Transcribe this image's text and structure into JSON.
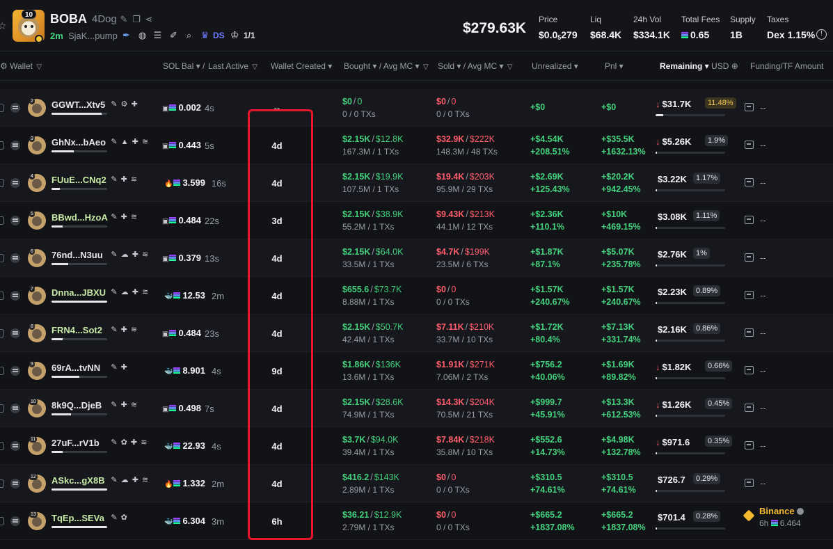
{
  "header": {
    "token_badge": "10",
    "token_name": "BOBA",
    "token_ticker": "4Dog",
    "age": "2m",
    "contract": "SjaK...pump",
    "ds_label": "DS",
    "holders_ratio": "1/1",
    "market_cap": "$279.63K",
    "stats": [
      {
        "label": "Price",
        "value_main": "$0.0",
        "value_sub": "5",
        "value_end": "279"
      },
      {
        "label": "Liq",
        "value": "$68.4K"
      },
      {
        "label": "24h Vol",
        "value": "$334.1K"
      },
      {
        "label": "Total Fees",
        "value": "0.65"
      },
      {
        "label": "Supply",
        "value": "1B"
      },
      {
        "label": "Taxes",
        "value": "Dex 1.15%"
      }
    ]
  },
  "columns": {
    "wallet": "Wallet",
    "sol_bal": "SOL Bal",
    "last_active": "Last Active",
    "wallet_created": "Wallet Created",
    "bought": "Bought",
    "avg_mc_bought": "Avg MC",
    "sold": "Sold",
    "avg_mc_sold": "Avg MC",
    "unrealized": "Unrealized",
    "pnl": "Pnl",
    "remaining": "Remaining",
    "remaining_unit": "USD",
    "funding": "Funding/TF Amount"
  },
  "rows": [
    {
      "rank": "2",
      "wallet": "GGWT...Xtv5",
      "name_color": "white",
      "bar": 0.9,
      "icons": "✎ ⚙ ✚",
      "bal_prefix": "▣",
      "bal_type": "",
      "sol_bal": "0.002",
      "last_active": "4s",
      "created": "--",
      "bought": "$0",
      "bought_mc": "0",
      "bought_sub": "0 / 0 TXs",
      "sold": "$0",
      "sold_mc": "0",
      "sold_sub": "0 / 0 TXs",
      "unr1": "+$0",
      "unr2": "",
      "pnl1": "+$0",
      "pnl2": "",
      "rem_arrow": "↓",
      "remaining": "$31.7K",
      "rem_pct": "11.48%",
      "rem_yellow": true,
      "rem_bar": 0.11,
      "funding": "--"
    },
    {
      "rank": "3",
      "wallet": "GhNx...bAeo",
      "name_color": "white",
      "bar": 0.4,
      "icons": "✎ ▲ ✚ ≋",
      "bal_prefix": "▣",
      "bal_type": "",
      "sol_bal": "0.443",
      "last_active": "5s",
      "created": "4d",
      "bought": "$2.15K",
      "bought_mc": "$12.8K",
      "bought_sub": "167.3M / 1 TXs",
      "sold": "$32.9K",
      "sold_mc": "$222K",
      "sold_sub": "148.3M / 48 TXs",
      "unr1": "+$4.54K",
      "unr2": "+208.51%",
      "pnl1": "+$35.5K",
      "pnl2": "+1632.13%",
      "rem_arrow": "↓",
      "remaining": "$5.26K",
      "rem_pct": "1.9%",
      "rem_yellow": false,
      "rem_bar": 0.02,
      "funding": "--"
    },
    {
      "rank": "4",
      "wallet": "FUuE...CNq2",
      "name_color": "green",
      "bar": 0.15,
      "icons": "✎ ✚ ≋",
      "bal_prefix": "🔥",
      "bal_type": "fire",
      "sol_bal": "3.599",
      "last_active": "16s",
      "created": "4d",
      "bought": "$2.15K",
      "bought_mc": "$19.9K",
      "bought_sub": "107.5M / 1 TXs",
      "sold": "$19.4K",
      "sold_mc": "$203K",
      "sold_sub": "95.9M / 29 TXs",
      "unr1": "+$2.69K",
      "unr2": "+125.43%",
      "pnl1": "+$20.2K",
      "pnl2": "+942.45%",
      "rem_arrow": "",
      "remaining": "$3.22K",
      "rem_pct": "1.17%",
      "rem_yellow": false,
      "rem_bar": 0.012,
      "funding": "--"
    },
    {
      "rank": "5",
      "wallet": "BBwd...HzoA",
      "name_color": "green",
      "bar": 0.2,
      "icons": "✎ ✚ ≋",
      "bal_prefix": "▣",
      "bal_type": "",
      "sol_bal": "0.484",
      "last_active": "22s",
      "created": "3d",
      "bought": "$2.15K",
      "bought_mc": "$38.9K",
      "bought_sub": "55.2M / 1 TXs",
      "sold": "$9.43K",
      "sold_mc": "$213K",
      "sold_sub": "44.1M / 12 TXs",
      "unr1": "+$2.36K",
      "unr2": "+110.1%",
      "pnl1": "+$10K",
      "pnl2": "+469.15%",
      "rem_arrow": "",
      "remaining": "$3.08K",
      "rem_pct": "1.11%",
      "rem_yellow": false,
      "rem_bar": 0.011,
      "funding": "--"
    },
    {
      "rank": "6",
      "wallet": "76nd...N3uu",
      "name_color": "white",
      "bar": 0.3,
      "icons": "✎ ☁ ✚ ≋",
      "bal_prefix": "▣",
      "bal_type": "",
      "sol_bal": "0.379",
      "last_active": "13s",
      "created": "4d",
      "bought": "$2.15K",
      "bought_mc": "$64.0K",
      "bought_sub": "33.5M / 1 TXs",
      "sold": "$4.7K",
      "sold_mc": "$199K",
      "sold_sub": "23.5M / 6 TXs",
      "unr1": "+$1.87K",
      "unr2": "+87.1%",
      "pnl1": "+$5.07K",
      "pnl2": "+235.78%",
      "rem_arrow": "",
      "remaining": "$2.76K",
      "rem_pct": "1%",
      "rem_yellow": false,
      "rem_bar": 0.01,
      "funding": "--"
    },
    {
      "rank": "7",
      "wallet": "Dnna...JBXU",
      "name_color": "green",
      "bar": 1.0,
      "icons": "✎ ☁ ✚ ≋",
      "bal_prefix": "🐳",
      "bal_type": "fish",
      "sol_bal": "12.53",
      "last_active": "2m",
      "created": "4d",
      "bought": "$655.6",
      "bought_mc": "$73.7K",
      "bought_sub": "8.88M / 1 TXs",
      "sold": "$0",
      "sold_mc": "0",
      "sold_sub": "0 / 0 TXs",
      "unr1": "+$1.57K",
      "unr2": "+240.67%",
      "pnl1": "+$1.57K",
      "pnl2": "+240.67%",
      "rem_arrow": "",
      "remaining": "$2.23K",
      "rem_pct": "0.89%",
      "rem_yellow": false,
      "rem_bar": 0.009,
      "funding": "--"
    },
    {
      "rank": "8",
      "wallet": "FRN4...Sot2",
      "name_color": "green",
      "bar": 0.2,
      "icons": "✎ ✚ ≋",
      "bal_prefix": "▣",
      "bal_type": "",
      "sol_bal": "0.484",
      "last_active": "23s",
      "created": "4d",
      "bought": "$2.15K",
      "bought_mc": "$50.7K",
      "bought_sub": "42.4M / 1 TXs",
      "sold": "$7.11K",
      "sold_mc": "$210K",
      "sold_sub": "33.7M / 10 TXs",
      "unr1": "+$1.72K",
      "unr2": "+80.4%",
      "pnl1": "+$7.13K",
      "pnl2": "+331.74%",
      "rem_arrow": "",
      "remaining": "$2.16K",
      "rem_pct": "0.86%",
      "rem_yellow": false,
      "rem_bar": 0.009,
      "funding": "--"
    },
    {
      "rank": "9",
      "wallet": "69rA...tvNN",
      "name_color": "white",
      "bar": 0.5,
      "icons": "✎ ✚",
      "bal_prefix": "🐳",
      "bal_type": "fish",
      "sol_bal": "8.901",
      "last_active": "4s",
      "created": "9d",
      "bought": "$1.86K",
      "bought_mc": "$136K",
      "bought_sub": "13.6M / 1 TXs",
      "sold": "$1.91K",
      "sold_mc": "$271K",
      "sold_sub": "7.06M / 2 TXs",
      "unr1": "+$756.2",
      "unr2": "+40.06%",
      "pnl1": "+$1.69K",
      "pnl2": "+89.82%",
      "rem_arrow": "↓",
      "remaining": "$1.82K",
      "rem_pct": "0.66%",
      "rem_yellow": false,
      "rem_bar": 0.007,
      "funding": "--"
    },
    {
      "rank": "10",
      "wallet": "8k9Q...DjeB",
      "name_color": "white",
      "bar": 0.35,
      "icons": "✎ ✚ ≋",
      "bal_prefix": "▣",
      "bal_type": "",
      "sol_bal": "0.498",
      "last_active": "7s",
      "created": "4d",
      "bought": "$2.15K",
      "bought_mc": "$28.6K",
      "bought_sub": "74.9M / 1 TXs",
      "sold": "$14.3K",
      "sold_mc": "$204K",
      "sold_sub": "70.5M / 21 TXs",
      "unr1": "+$999.7",
      "unr2": "+45.91%",
      "pnl1": "+$13.3K",
      "pnl2": "+612.53%",
      "rem_arrow": "↓",
      "remaining": "$1.26K",
      "rem_pct": "0.45%",
      "rem_yellow": false,
      "rem_bar": 0.005,
      "funding": "--"
    },
    {
      "rank": "11",
      "wallet": "27uF...rV1b",
      "name_color": "white",
      "bar": 0.2,
      "icons": "✎ ✿ ✚ ≋",
      "bal_prefix": "🐳",
      "bal_type": "fish",
      "sol_bal": "22.93",
      "last_active": "4s",
      "created": "4d",
      "bought": "$3.7K",
      "bought_mc": "$94.0K",
      "bought_sub": "39.4M / 1 TXs",
      "sold": "$7.84K",
      "sold_mc": "$218K",
      "sold_sub": "35.8M / 10 TXs",
      "unr1": "+$552.6",
      "unr2": "+14.73%",
      "pnl1": "+$4.98K",
      "pnl2": "+132.78%",
      "rem_arrow": "↓",
      "remaining": "$971.6",
      "rem_pct": "0.35%",
      "rem_yellow": false,
      "rem_bar": 0.004,
      "funding": "--"
    },
    {
      "rank": "12",
      "wallet": "ASkc...gX8B",
      "name_color": "green",
      "bar": 1.0,
      "icons": "✎ ☁ ✚ ≋",
      "bal_prefix": "🔥",
      "bal_type": "fire",
      "sol_bal": "1.332",
      "last_active": "2m",
      "created": "4d",
      "bought": "$416.2",
      "bought_mc": "$143K",
      "bought_sub": "2.89M / 1 TXs",
      "sold": "$0",
      "sold_mc": "0",
      "sold_sub": "0 / 0 TXs",
      "unr1": "+$310.5",
      "unr2": "+74.61%",
      "pnl1": "+$310.5",
      "pnl2": "+74.61%",
      "rem_arrow": "",
      "remaining": "$726.7",
      "rem_pct": "0.29%",
      "rem_yellow": false,
      "rem_bar": 0.003,
      "funding": "--"
    },
    {
      "rank": "13",
      "wallet": "TqEp...SEVa",
      "name_color": "green",
      "bar": 1.0,
      "icons": "✎ ✿",
      "bal_prefix": "🐳",
      "bal_type": "fish",
      "sol_bal": "6.304",
      "last_active": "3m",
      "created": "6h",
      "bought": "$36.21",
      "bought_mc": "$12.9K",
      "bought_sub": "2.79M / 1 TXs",
      "sold": "$0",
      "sold_mc": "0",
      "sold_sub": "0 / 0 TXs",
      "unr1": "+$665.2",
      "unr2": "+1837.08%",
      "pnl1": "+$665.2",
      "pnl2": "+1837.08%",
      "rem_arrow": "",
      "remaining": "$701.4",
      "rem_pct": "0.28%",
      "rem_yellow": false,
      "rem_bar": 0.003,
      "funding": "",
      "funding_name": "Binance",
      "funding_sub": "6h",
      "funding_amount": "6.464"
    }
  ],
  "colors": {
    "green": "#44d17d",
    "red": "#ff5c6c",
    "highlight": "#e8162b",
    "background": "#121317"
  }
}
